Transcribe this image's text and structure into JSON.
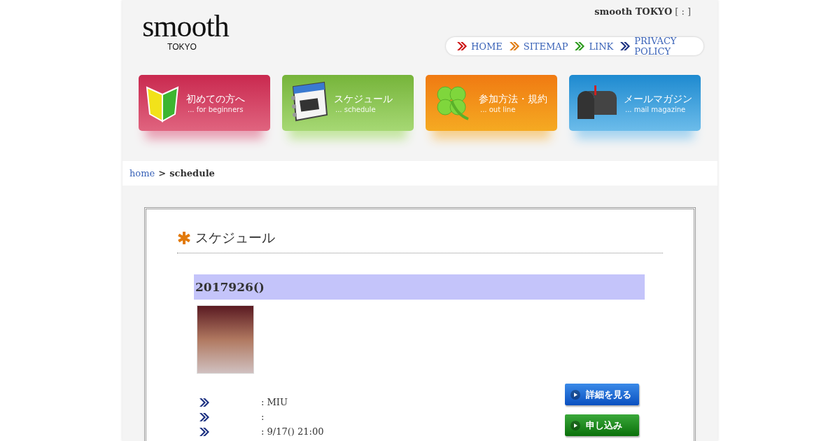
{
  "header": {
    "logo": "smooth",
    "logo_sub": "TOKYO",
    "site_name": "smooth TOKYO",
    "site_suffix": "[ : ]"
  },
  "nav_links": [
    {
      "label": "HOME",
      "color": "#cc1111"
    },
    {
      "label": "SITEMAP",
      "color": "#e07b10"
    },
    {
      "label": "LINK",
      "color": "#2a9a1a"
    },
    {
      "label": "PRIVACY POLICY",
      "color": "#1a2f80"
    }
  ],
  "menu_tiles": [
    {
      "kind": "beginner",
      "title": "初めての方へ",
      "subtitle": "... for beginners"
    },
    {
      "kind": "calendar",
      "title": "スケジュール",
      "subtitle": "... schedule"
    },
    {
      "kind": "clover",
      "title": "参加方法・規約",
      "subtitle": "... out line"
    },
    {
      "kind": "mailbox",
      "title": "メールマガジン",
      "subtitle": "... mail magazine"
    }
  ],
  "breadcrumb": {
    "link": "home",
    "separator": ">",
    "current": "schedule"
  },
  "section_title": "スケジュール",
  "entry": {
    "date": "2017926()",
    "rows": [
      {
        "value": ": MIU"
      },
      {
        "value": ":"
      },
      {
        "value": ": 9/17() 21:00"
      }
    ],
    "buttons": [
      {
        "kind": "details",
        "label": "詳細を見る"
      },
      {
        "kind": "apply",
        "label": "申し込み"
      }
    ]
  }
}
